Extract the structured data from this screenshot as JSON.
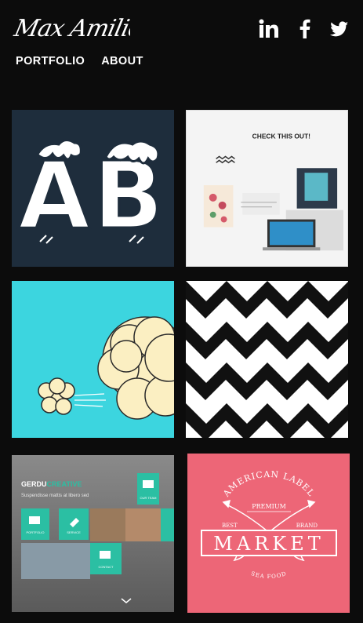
{
  "header": {
    "logo_text": "Max Amilion",
    "social": [
      {
        "name": "linkedin",
        "icon": "linkedin-icon"
      },
      {
        "name": "facebook",
        "icon": "facebook-icon"
      },
      {
        "name": "twitter",
        "icon": "twitter-icon"
      }
    ]
  },
  "nav": {
    "portfolio_label": "PORTFOLIO",
    "about_label": "ABOUT"
  },
  "portfolio": {
    "tile1": {
      "letters": "AB"
    },
    "tile2": {
      "headline": "CHECK THIS OUT!"
    },
    "tile3": {
      "label": ""
    },
    "tile4": {
      "label": ""
    },
    "tile5": {
      "brand": "GERDU",
      "brand_accent": "CREATIVE",
      "tagline": "Suspendisse mattis at libero sed",
      "menu": [
        "OUR TEAM",
        "PORTFOLIO",
        "SERVICE",
        "CONTACT"
      ]
    },
    "tile6": {
      "top_arc": "AMERICAN LABEL",
      "premium": "PREMIUM",
      "best": "BEST",
      "brand": "BRAND",
      "title": "MARKET",
      "bottom_arc": "SEA FOOD"
    }
  },
  "colors": {
    "background": "#0c0c0c",
    "tile1": "#1e2d3c",
    "tile3": "#3cd5df",
    "tile5_accent": "#2bbfa3",
    "tile6": "#ed6677"
  }
}
